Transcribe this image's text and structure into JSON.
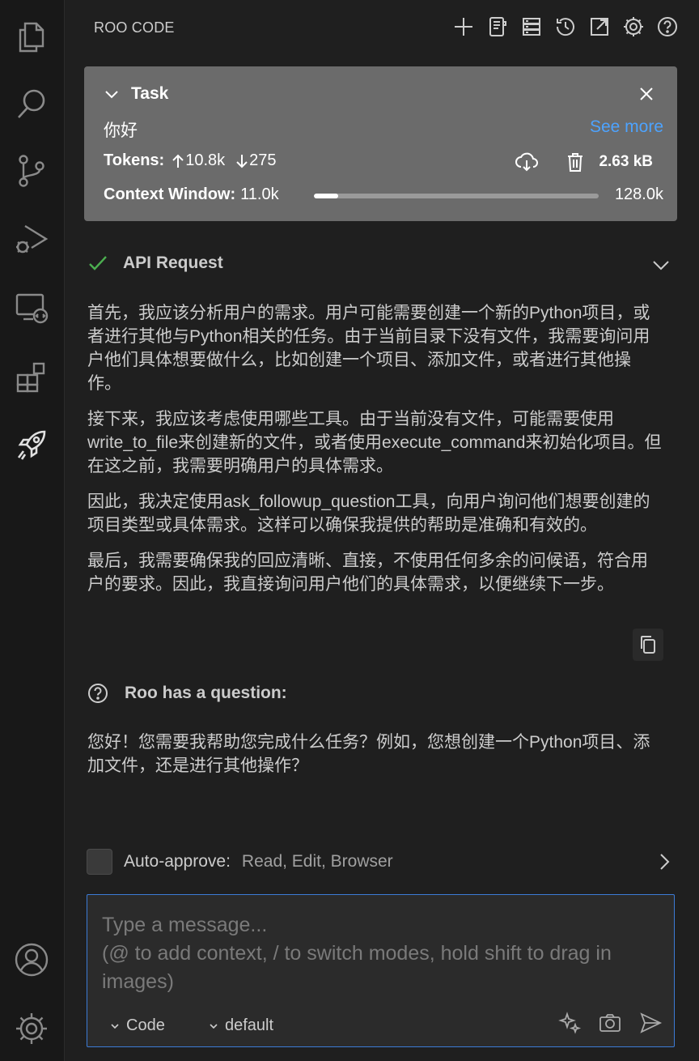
{
  "header": {
    "title": "ROO CODE"
  },
  "header_actions": [
    {
      "name": "new-task-icon"
    },
    {
      "name": "prompts-icon"
    },
    {
      "name": "mcp-servers-icon"
    },
    {
      "name": "history-icon"
    },
    {
      "name": "popout-icon"
    },
    {
      "name": "settings-icon"
    },
    {
      "name": "help-icon"
    }
  ],
  "task": {
    "title": "Task",
    "text": "你好",
    "see_more": "See more",
    "tokens_label": "Tokens:",
    "tokens_in": "10.8k",
    "tokens_out": "275",
    "size": "2.63 kB",
    "context_label": "Context Window:",
    "context_used": "11.0k",
    "context_max": "128.0k",
    "context_fraction": 0.086
  },
  "api_request": {
    "label": "API Request"
  },
  "reasoning": [
    "首先，我应该分析用户的需求。用户可能需要创建一个新的Python项目，或者进行其他与Python相关的任务。由于当前目录下没有文件，我需要询问用户他们具体想要做什么，比如创建一个项目、添加文件，或者进行其他操作。",
    "接下来，我应该考虑使用哪些工具。由于当前没有文件，可能需要使用write_to_file来创建新的文件，或者使用execute_command来初始化项目。但在这之前，我需要明确用户的具体需求。",
    "因此，我决定使用ask_followup_question工具，向用户询问他们想要创建的项目类型或具体需求。这样可以确保我提供的帮助是准确和有效的。",
    "最后，我需要确保我的回应清晰、直接，不使用任何多余的问候语，符合用户的要求。因此，我直接询问用户他们的具体需求，以便继续下一步。"
  ],
  "question": {
    "label": "Roo has a question:",
    "text": "您好！您需要我帮助您完成什么任务？例如，您想创建一个Python项目、添加文件，还是进行其他操作？"
  },
  "auto_approve": {
    "label": "Auto-approve:",
    "values": "Read, Edit, Browser"
  },
  "input": {
    "placeholder": "Type a message...\n(@ to add context, / to switch modes, hold shift to drag in images)",
    "mode": "Code",
    "config": "default"
  },
  "colors": {
    "accent": "#3c7bd6",
    "link": "#4da3ff",
    "success": "#4caf50",
    "task_bg": "#6b6b6b"
  }
}
